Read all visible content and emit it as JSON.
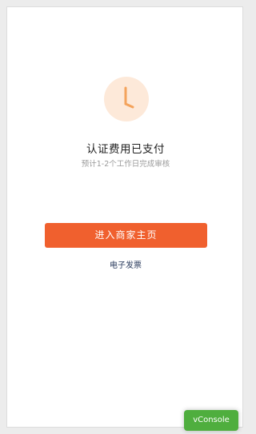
{
  "status": {
    "title": "认证费用已支付",
    "subtitle": "预计1-2个工作日完成审核"
  },
  "actions": {
    "enter_home_label": "进入商家主页",
    "invoice_label": "电子发票"
  },
  "vconsole": {
    "label": "vConsole"
  },
  "icons": {
    "status_icon": "clock-icon"
  },
  "colors": {
    "primary": "#f0602e",
    "clock_bg": "#fde9d9",
    "clock_hand": "#f4a35c",
    "link": "#2b3c5e",
    "vconsole": "#4fae3e"
  }
}
